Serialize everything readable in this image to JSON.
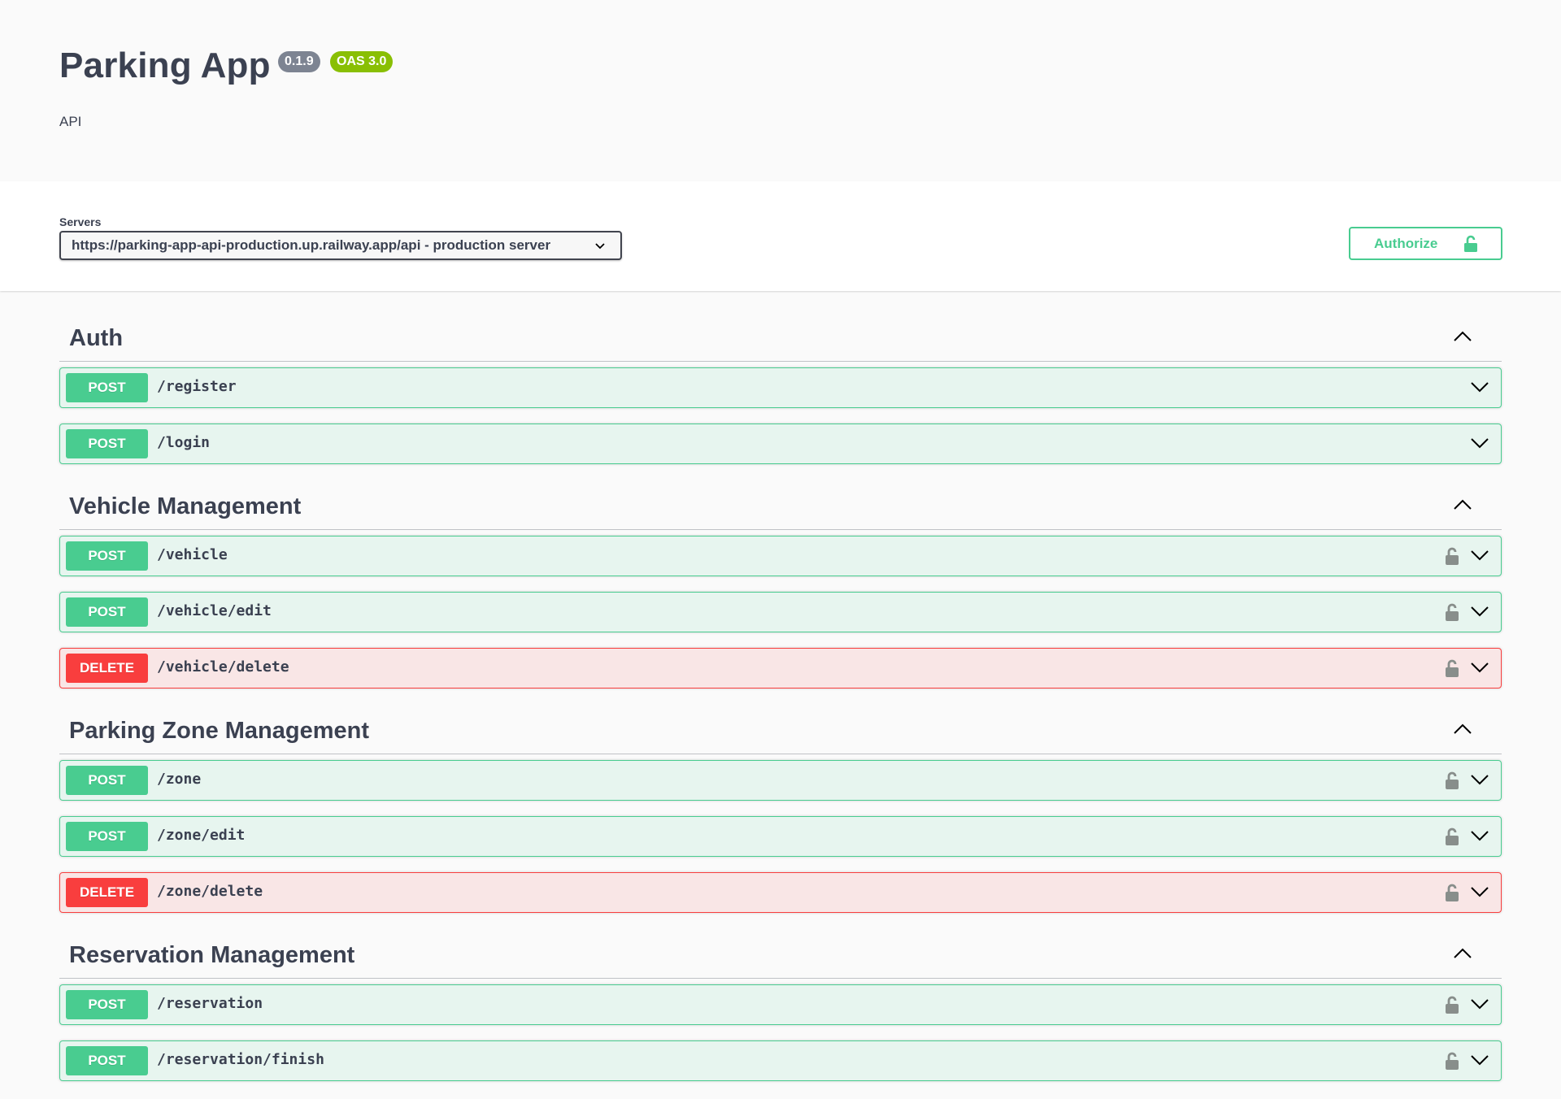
{
  "info": {
    "title": "Parking App",
    "version": "0.1.9",
    "oas_badge": "OAS 3.0",
    "description": "API"
  },
  "servers": {
    "label": "Servers",
    "selected": "https://parking-app-api-production.up.railway.app/api - production server"
  },
  "authorize": {
    "label": "Authorize",
    "icon": "unlocked-lock-icon"
  },
  "colors": {
    "post": "#49cc90",
    "delete": "#f93e3e",
    "version_badge": "#7d8492",
    "oas_badge": "#89bf04",
    "text": "#3b4151"
  },
  "tags": [
    {
      "name": "Auth",
      "expanded": true,
      "operations": [
        {
          "method": "POST",
          "path": "/register",
          "locked_icon": false
        },
        {
          "method": "POST",
          "path": "/login",
          "locked_icon": false
        }
      ]
    },
    {
      "name": "Vehicle Management",
      "expanded": true,
      "operations": [
        {
          "method": "POST",
          "path": "/vehicle",
          "locked_icon": true
        },
        {
          "method": "POST",
          "path": "/vehicle/edit",
          "locked_icon": true
        },
        {
          "method": "DELETE",
          "path": "/vehicle/delete",
          "locked_icon": true
        }
      ]
    },
    {
      "name": "Parking Zone Management",
      "expanded": true,
      "operations": [
        {
          "method": "POST",
          "path": "/zone",
          "locked_icon": true
        },
        {
          "method": "POST",
          "path": "/zone/edit",
          "locked_icon": true
        },
        {
          "method": "DELETE",
          "path": "/zone/delete",
          "locked_icon": true
        }
      ]
    },
    {
      "name": "Reservation Management",
      "expanded": true,
      "operations": [
        {
          "method": "POST",
          "path": "/reservation",
          "locked_icon": true
        },
        {
          "method": "POST",
          "path": "/reservation/finish",
          "locked_icon": true
        }
      ]
    }
  ]
}
